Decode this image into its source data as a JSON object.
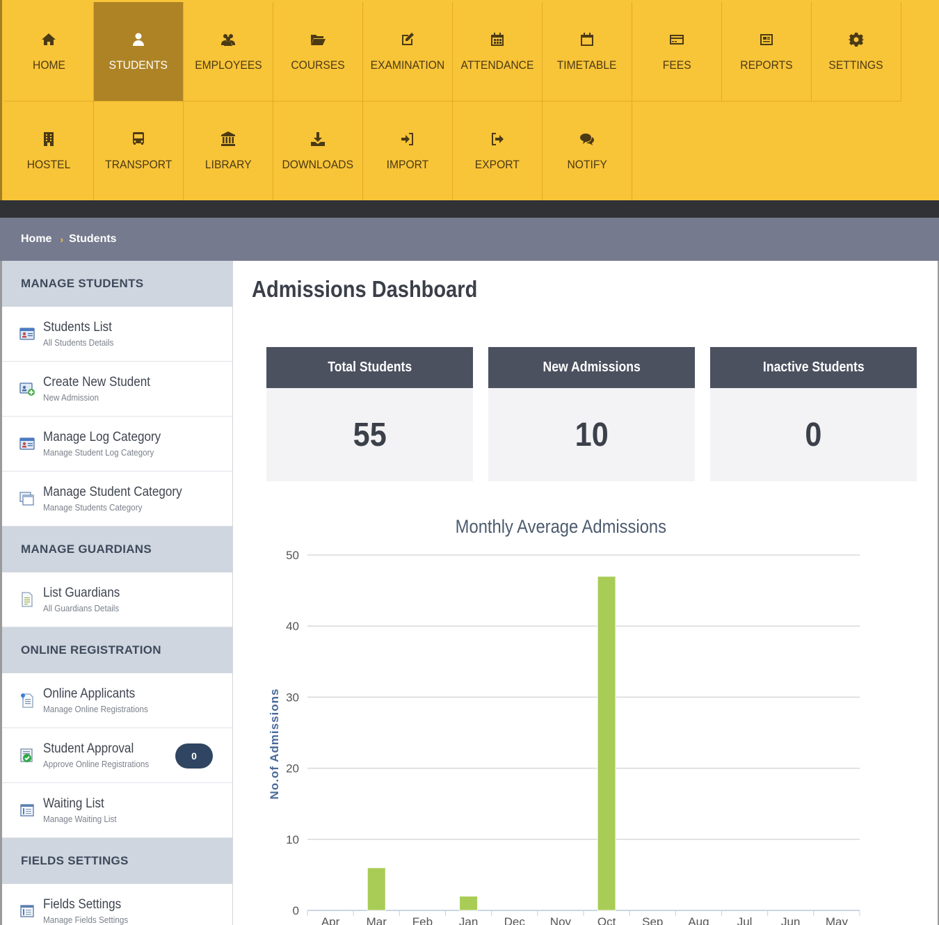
{
  "nav": {
    "row1": [
      {
        "label": "HOME",
        "icon": "home-icon",
        "active": false
      },
      {
        "label": "STUDENTS",
        "icon": "user-icon",
        "active": true
      },
      {
        "label": "EMPLOYEES",
        "icon": "users-icon",
        "active": false
      },
      {
        "label": "COURSES",
        "icon": "folder-open-icon",
        "active": false
      },
      {
        "label": "EXAMINATION",
        "icon": "edit-icon",
        "active": false
      },
      {
        "label": "ATTENDANCE",
        "icon": "calendar-grid-icon",
        "active": false
      },
      {
        "label": "TIMETABLE",
        "icon": "calendar-icon",
        "active": false
      },
      {
        "label": "FEES",
        "icon": "credit-card-icon",
        "active": false
      },
      {
        "label": "REPORTS",
        "icon": "newspaper-icon",
        "active": false
      },
      {
        "label": "SETTINGS",
        "icon": "gear-icon",
        "active": false
      }
    ],
    "row2": [
      {
        "label": "HOSTEL",
        "icon": "building-icon",
        "active": false
      },
      {
        "label": "TRANSPORT",
        "icon": "bus-icon",
        "active": false
      },
      {
        "label": "LIBRARY",
        "icon": "bank-icon",
        "active": false
      },
      {
        "label": "DOWNLOADS",
        "icon": "download-icon",
        "active": false
      },
      {
        "label": "IMPORT",
        "icon": "sign-in-icon",
        "active": false
      },
      {
        "label": "EXPORT",
        "icon": "sign-out-icon",
        "active": false
      },
      {
        "label": "NOTIFY",
        "icon": "comments-icon",
        "active": false
      }
    ]
  },
  "breadcrumb": {
    "home": "Home",
    "separator": "›",
    "current": "Students"
  },
  "sidebar": {
    "sections": [
      {
        "title": "MANAGE STUDENTS",
        "items": [
          {
            "title": "Students List",
            "subtitle": "All Students Details",
            "icon": "id-card-icon"
          },
          {
            "title": "Create New Student",
            "subtitle": "New Admission",
            "icon": "add-user-card-icon"
          },
          {
            "title": "Manage Log Category",
            "subtitle": "Manage Student Log Category",
            "icon": "id-card-icon"
          },
          {
            "title": "Manage Student Category",
            "subtitle": "Manage Students Category",
            "icon": "windows-icon"
          }
        ]
      },
      {
        "title": "MANAGE GUARDIANS",
        "items": [
          {
            "title": "List Guardians",
            "subtitle": "All Guardians Details",
            "icon": "document-icon"
          }
        ]
      },
      {
        "title": "ONLINE REGISTRATION",
        "items": [
          {
            "title": "Online Applicants",
            "subtitle": "Manage Online Registrations",
            "icon": "document-pin-icon"
          },
          {
            "title": "Student Approval",
            "subtitle": "Approve Online Registrations",
            "icon": "approval-check-icon",
            "badge": "0"
          },
          {
            "title": "Waiting List",
            "subtitle": "Manage Waiting List",
            "icon": "list-window-icon"
          }
        ]
      },
      {
        "title": "FIELDS SETTINGS",
        "items": [
          {
            "title": "Fields Settings",
            "subtitle": "Manage Fields Settings",
            "icon": "list-window-icon"
          }
        ]
      }
    ]
  },
  "main": {
    "title": "Admissions Dashboard",
    "stats": [
      {
        "label": "Total Students",
        "value": "55"
      },
      {
        "label": "New Admissions",
        "value": "10"
      },
      {
        "label": "Inactive Students",
        "value": "0"
      }
    ]
  },
  "chart_data": {
    "type": "bar",
    "title": "Monthly Average Admissions",
    "xlabel": "",
    "ylabel": "No.of Admissions",
    "categories": [
      "Apr",
      "Mar",
      "Feb",
      "Jan",
      "Dec",
      "Nov",
      "Oct",
      "Sep",
      "Aug",
      "Jul",
      "Jun",
      "May"
    ],
    "values": [
      0,
      6,
      0,
      2,
      0,
      0,
      47,
      0,
      0,
      0,
      0,
      0
    ],
    "ylim": [
      0,
      50
    ],
    "yticks": [
      0,
      10,
      20,
      30,
      40,
      50
    ],
    "grid": true,
    "bar_color": "#a8cc55"
  },
  "colors": {
    "nav_bg": "#f8c438",
    "nav_active": "#ad8325",
    "breadcrumb_bg": "#767a8e",
    "stat_header": "#4b515f",
    "badge": "#2f4561"
  }
}
